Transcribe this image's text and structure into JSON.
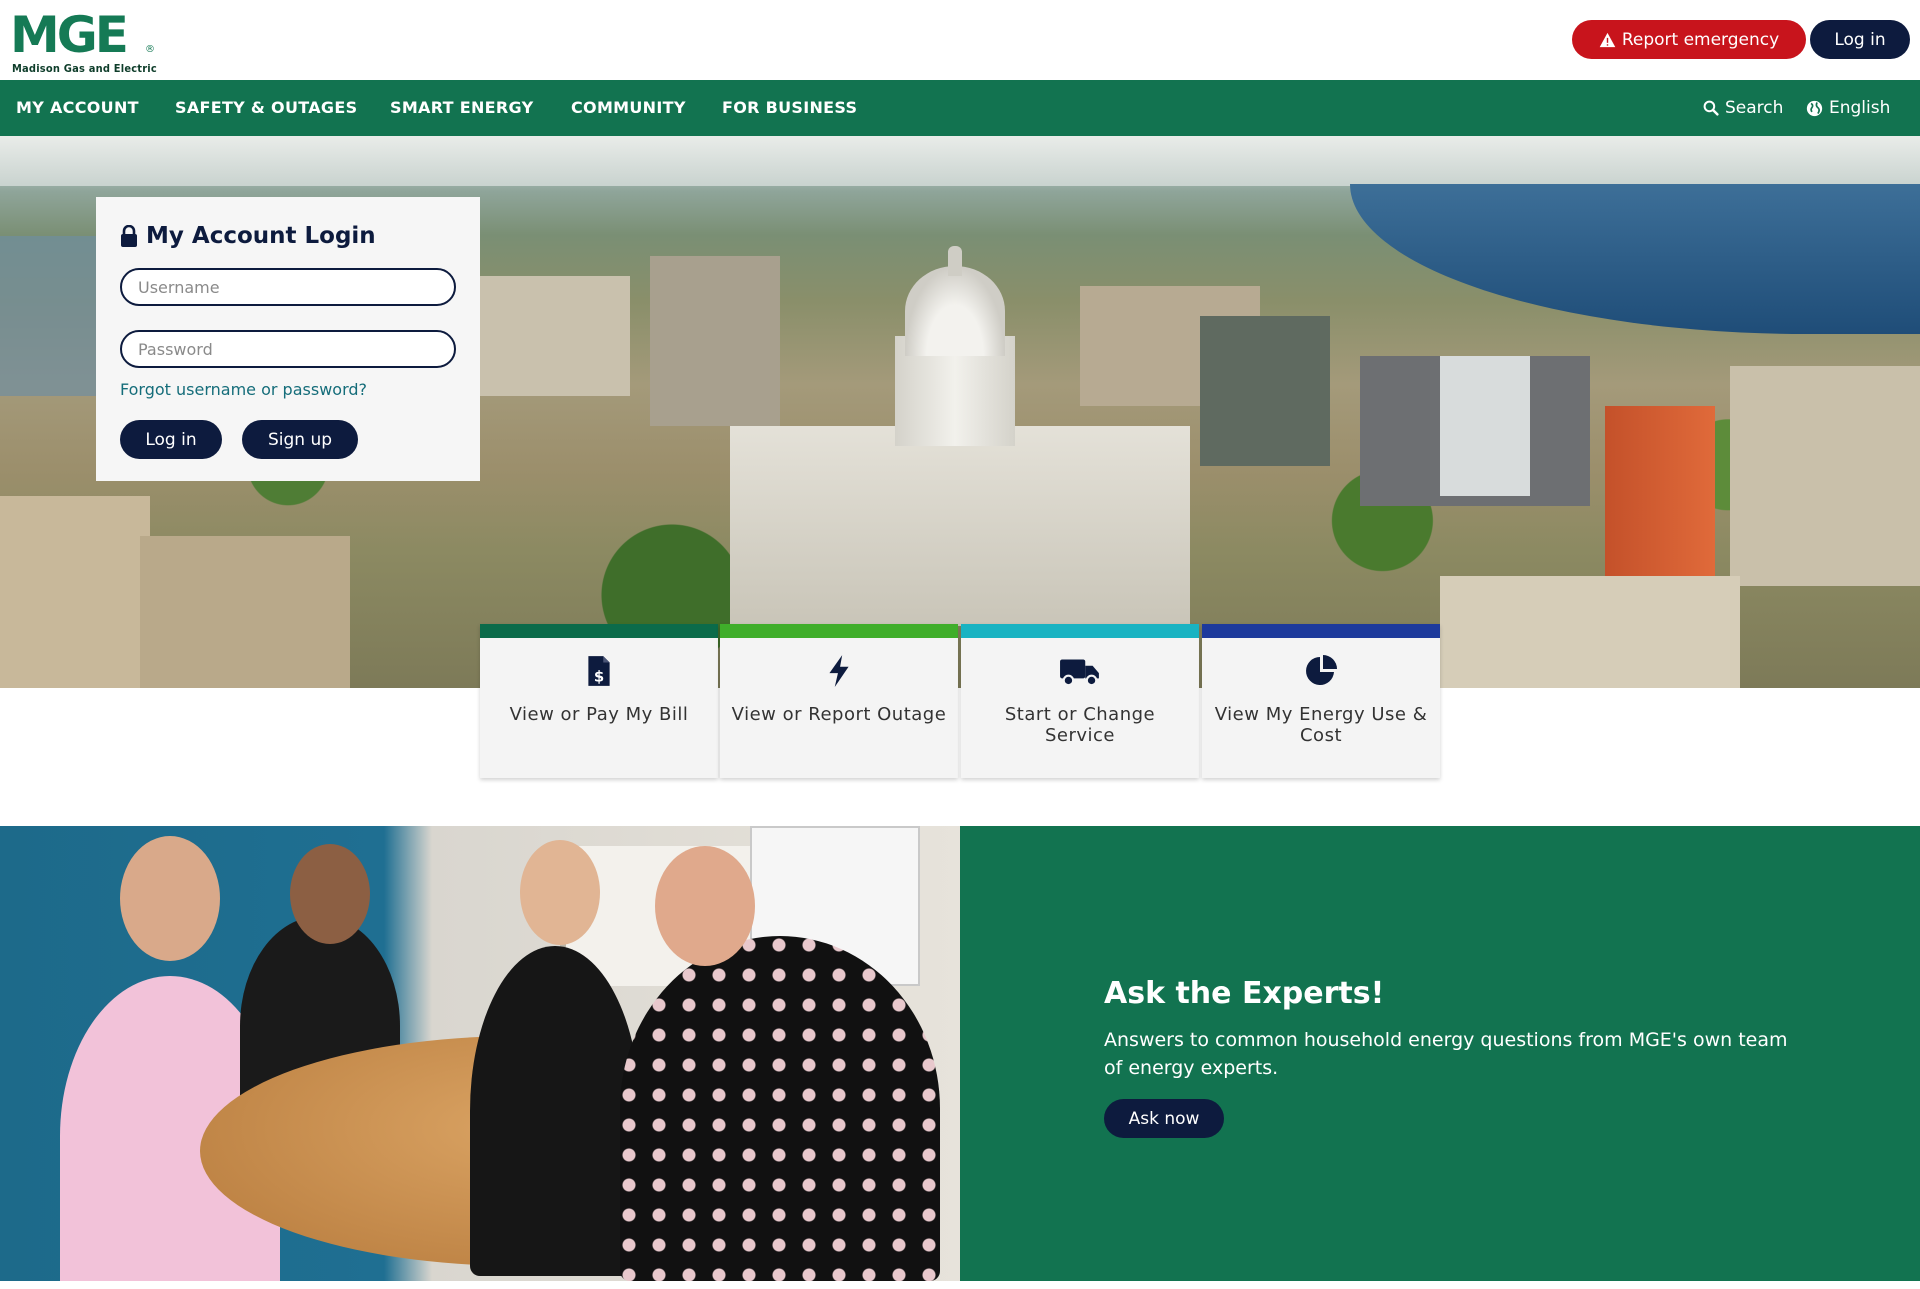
{
  "brand": {
    "logo_text": "MGE",
    "logo_subtitle": "Madison Gas and Electric",
    "logo_mark": "®",
    "primary_color": "#127350",
    "navy_color": "#0d1b3e",
    "emergency_color": "#c8141c"
  },
  "header": {
    "emergency_label": "Report emergency",
    "emergency_icon": "warning-triangle-icon",
    "login_label": "Log in"
  },
  "nav": {
    "items": [
      {
        "label": "MY ACCOUNT"
      },
      {
        "label": "SAFETY & OUTAGES"
      },
      {
        "label": "SMART ENERGY"
      },
      {
        "label": "COMMUNITY"
      },
      {
        "label": "FOR BUSINESS"
      }
    ],
    "search_label": "Search",
    "language_label": "English"
  },
  "login": {
    "title": "My Account Login",
    "username_placeholder": "Username",
    "password_placeholder": "Password",
    "forgot_label": "Forgot username or password?",
    "login_label": "Log in",
    "signup_label": "Sign up"
  },
  "tiles": [
    {
      "label": "View or Pay My Bill",
      "icon": "bill-dollar-icon",
      "color": "#0b6b4a"
    },
    {
      "label": "View or Report Outage",
      "icon": "lightning-bolt-icon",
      "color": "#3fae2a"
    },
    {
      "label": "Start or Change Service",
      "icon": "truck-icon",
      "color": "#19b3c2"
    },
    {
      "label": "View My Energy Use & Cost",
      "icon": "pie-chart-icon",
      "color": "#1d3a9c"
    }
  ],
  "experts": {
    "title": "Ask the Experts!",
    "text": "Answers to common household energy questions from MGE's own team of energy experts.",
    "button_label": "Ask now"
  }
}
